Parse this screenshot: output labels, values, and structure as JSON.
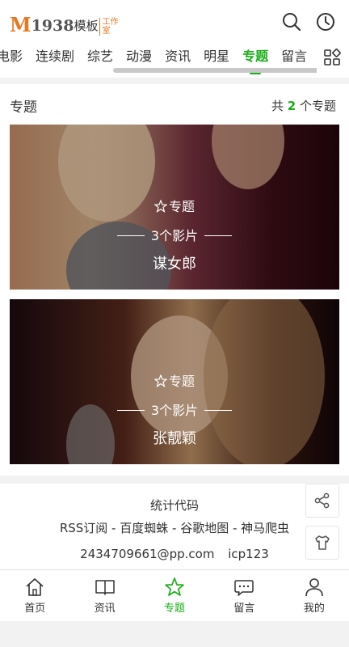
{
  "header": {
    "logo": {
      "m": "M",
      "num": "1938",
      "text": "模板",
      "studio_1": "工作",
      "studio_2": "室"
    },
    "icons": [
      "search-icon",
      "history-icon"
    ]
  },
  "nav": {
    "tabs": [
      {
        "label": "电影"
      },
      {
        "label": "连续剧"
      },
      {
        "label": "综艺"
      },
      {
        "label": "动漫"
      },
      {
        "label": "资讯"
      },
      {
        "label": "明星"
      },
      {
        "label": "专题",
        "active": true
      },
      {
        "label": "留言"
      }
    ],
    "more_icon": "grid-icon"
  },
  "section": {
    "title": "专题",
    "count_prefix": "共",
    "count": "2",
    "count_suffix": "个专题"
  },
  "cards": [
    {
      "type": "专题",
      "count": "3个影片",
      "title": "谋女郎"
    },
    {
      "type": "专题",
      "count": "3个影片",
      "title": "张靓颖"
    }
  ],
  "footer": {
    "stat": "统计代码",
    "links": "RSS订阅 - 百度蜘蛛 - 谷歌地图 - 神马爬虫",
    "email": "2434709661@pp.com",
    "icp": "icp123"
  },
  "tabbar": [
    {
      "label": "首页",
      "icon": "home-icon"
    },
    {
      "label": "资讯",
      "icon": "book-icon"
    },
    {
      "label": "专题",
      "icon": "star-icon",
      "active": true
    },
    {
      "label": "留言",
      "icon": "chat-icon"
    },
    {
      "label": "我的",
      "icon": "user-icon"
    }
  ],
  "colors": {
    "accent": "#1aad19",
    "logo": "#e87722"
  }
}
